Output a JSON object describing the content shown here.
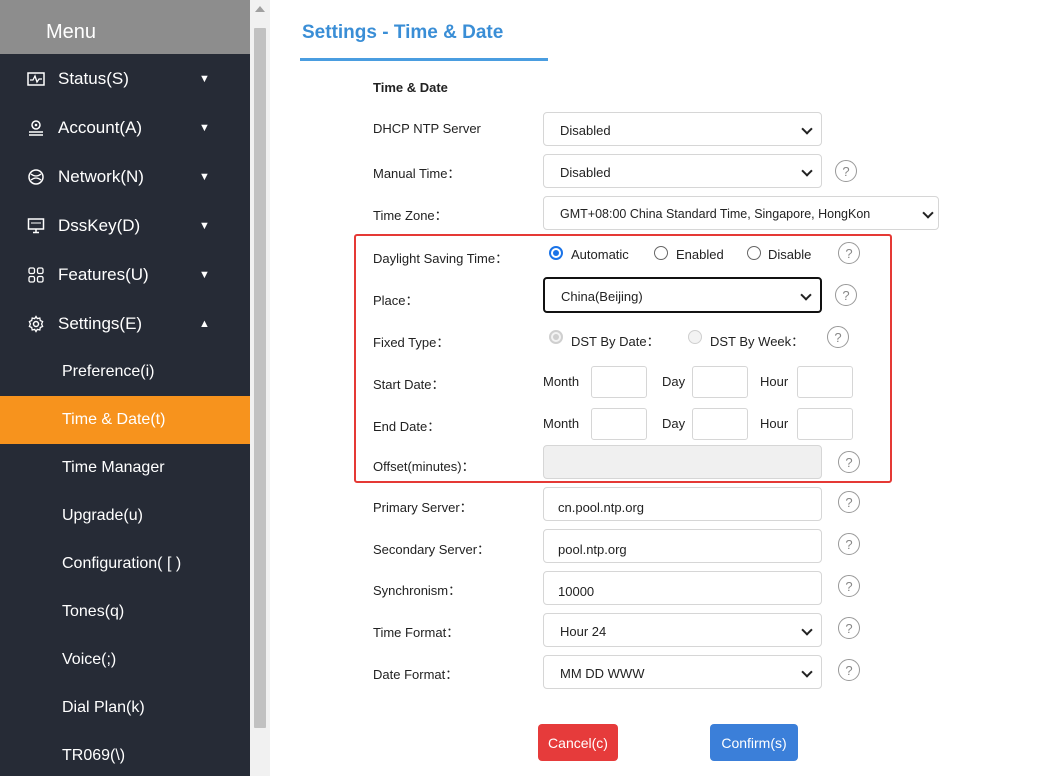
{
  "sidebar": {
    "header": "Menu",
    "groups": [
      {
        "label": "Status(S)",
        "arrow": "▼"
      },
      {
        "label": "Account(A)",
        "arrow": "▼"
      },
      {
        "label": "Network(N)",
        "arrow": "▼"
      },
      {
        "label": "DssKey(D)",
        "arrow": "▼"
      },
      {
        "label": "Features(U)",
        "arrow": "▼"
      },
      {
        "label": "Settings(E)",
        "arrow": "▲"
      }
    ],
    "subitems": [
      "Preference(i)",
      "Time & Date(t)",
      "Time Manager",
      "Upgrade(u)",
      "Configuration( [ )",
      "Tones(q)",
      "Voice(;)",
      "Dial Plan(k)",
      "TR069(\\)"
    ],
    "active_subitem": "Time & Date(t)"
  },
  "page": {
    "title": "Settings - Time & Date",
    "section": "Time & Date"
  },
  "form": {
    "dhcp_ntp": {
      "label": "DHCP NTP Server",
      "value": "Disabled"
    },
    "manual_time": {
      "label": "Manual Time：",
      "value": "Disabled"
    },
    "time_zone": {
      "label": "Time Zone：",
      "value": "GMT+08:00 China Standard Time, Singapore, HongKon"
    },
    "dst": {
      "label": "Daylight Saving Time：",
      "options": [
        "Automatic",
        "Enabled",
        "Disable"
      ],
      "selected": "Automatic"
    },
    "place": {
      "label": "Place：",
      "value": "China(Beijing)"
    },
    "fixed_type": {
      "label": "Fixed Type：",
      "options": [
        "DST By Date：",
        "DST By Week："
      ],
      "selected": "DST By Date"
    },
    "start_date": {
      "label": "Start Date：",
      "month": "Month",
      "day": "Day",
      "hour": "Hour"
    },
    "end_date": {
      "label": "End Date：",
      "month": "Month",
      "day": "Day",
      "hour": "Hour"
    },
    "offset": {
      "label": "Offset(minutes)：",
      "value": ""
    },
    "primary_server": {
      "label": "Primary Server：",
      "value": "cn.pool.ntp.org"
    },
    "secondary_server": {
      "label": "Secondary Server：",
      "value": "pool.ntp.org"
    },
    "synchronism": {
      "label": "Synchronism：",
      "value": "10000"
    },
    "time_format": {
      "label": "Time Format：",
      "value": "Hour 24"
    },
    "date_format": {
      "label": "Date Format：",
      "value": "MM DD WWW"
    },
    "help_glyph": "?"
  },
  "buttons": {
    "cancel": "Cancel(c)",
    "confirm": "Confirm(s)"
  },
  "colors": {
    "sidebar_bg": "#262b36",
    "active_item": "#f7931d",
    "title_blue": "#3a8ed6",
    "cancel_red": "#e63b3b",
    "confirm_blue": "#3b7fd9",
    "highlight_frame": "#e53935"
  }
}
